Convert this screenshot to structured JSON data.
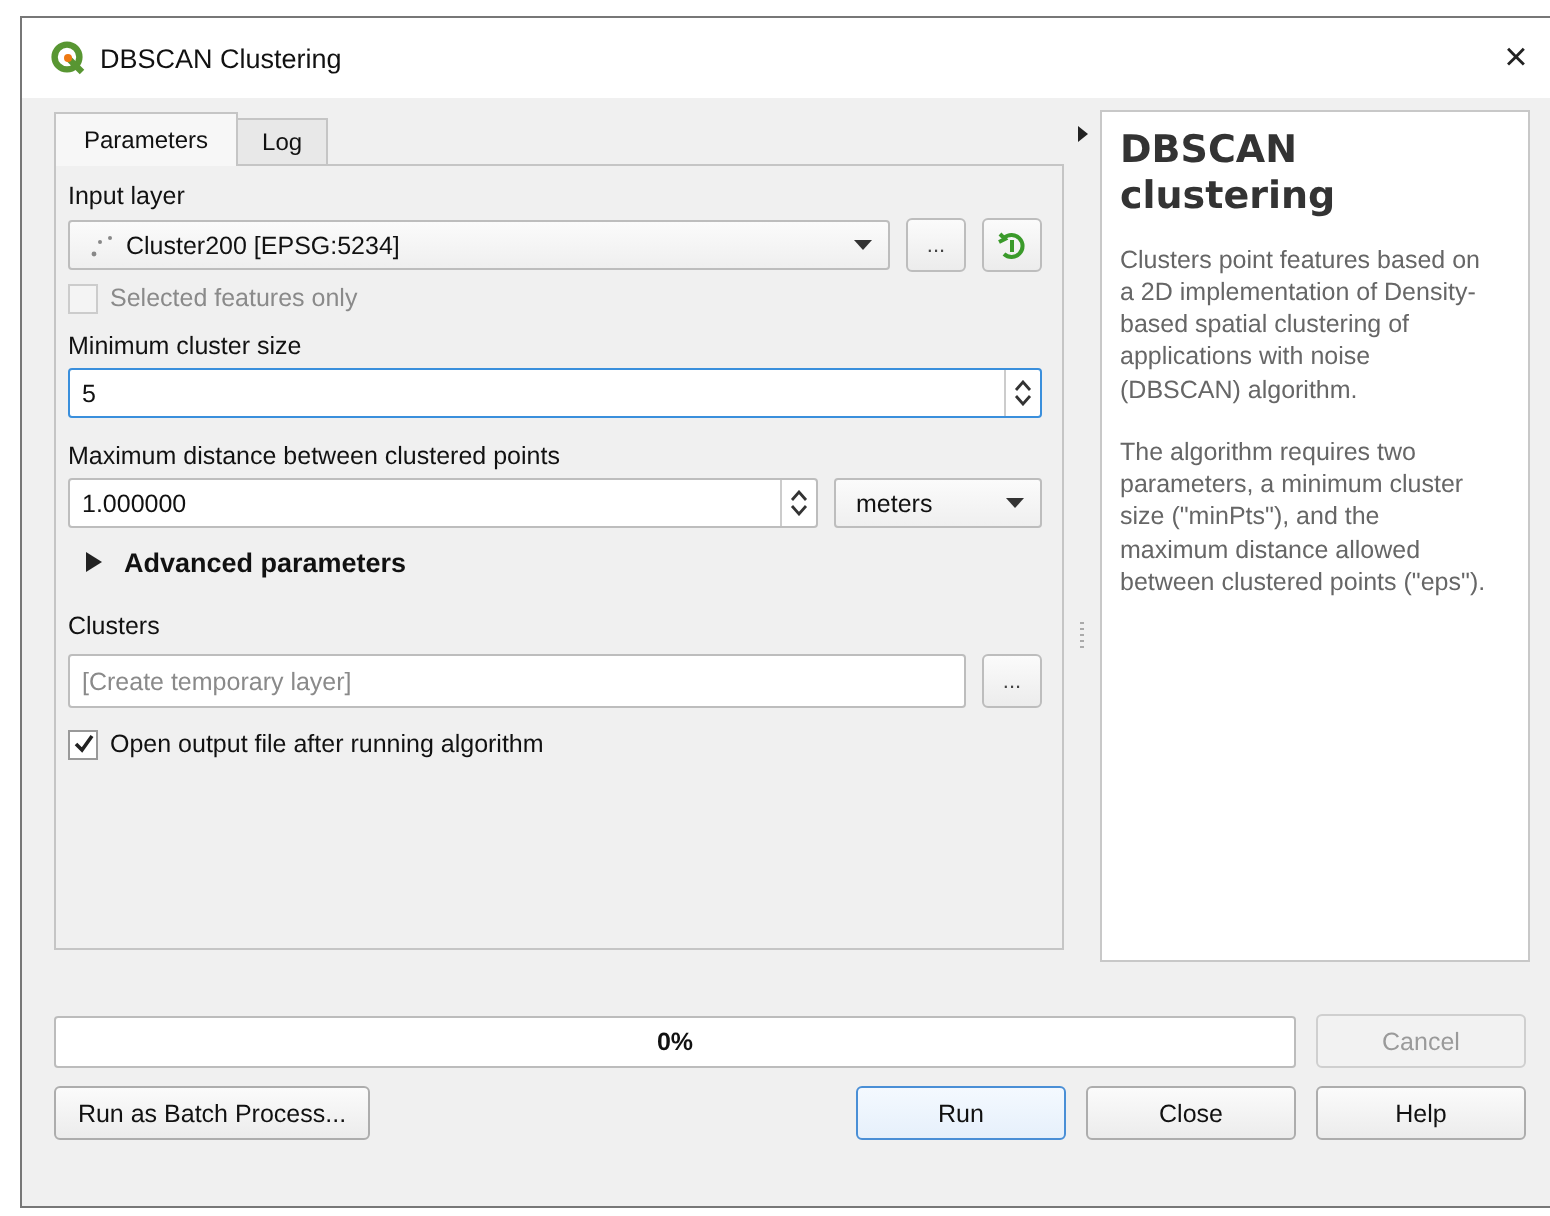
{
  "window": {
    "title": "DBSCAN Clustering",
    "close": "×"
  },
  "tabs": [
    {
      "label": "Parameters",
      "selected": true
    },
    {
      "label": "Log",
      "selected": false
    }
  ],
  "input_layer": {
    "label": "Input layer",
    "value": "Cluster200 [EPSG:5234]",
    "browse": "..."
  },
  "selected_only": {
    "label": "Selected features only",
    "checked": false,
    "disabled": true
  },
  "min_cluster": {
    "label": "Minimum cluster size",
    "value": "5",
    "focused": true
  },
  "max_distance": {
    "label": "Maximum distance between clustered points",
    "value": "1.000000",
    "unit": "meters"
  },
  "advanced": {
    "label": "Advanced parameters",
    "expanded": false
  },
  "clusters": {
    "label": "Clusters",
    "placeholder": "[Create temporary layer]",
    "browse": "..."
  },
  "open_output": {
    "label": "Open output file after running algorithm",
    "checked": true
  },
  "help": {
    "title": "DBSCAN clustering",
    "paragraphs": [
      "Clusters point features based on a 2D implementation of Density-based spatial clustering of applications with noise (DBSCAN) algorithm.",
      "The algorithm requires two parameters, a minimum cluster size (\"minPts\"), and the maximum distance allowed between clustered points (\"eps\")."
    ]
  },
  "progress": {
    "level": 0,
    "reading": "0%"
  },
  "cancel_button": {
    "label": "Cancel",
    "disabled": true
  },
  "buttons": [
    {
      "label": "Run as Batch Process...",
      "default": false
    },
    {
      "label": "Run",
      "default": true
    },
    {
      "label": "Close",
      "default": false
    },
    {
      "label": "Help",
      "default": false
    }
  ]
}
